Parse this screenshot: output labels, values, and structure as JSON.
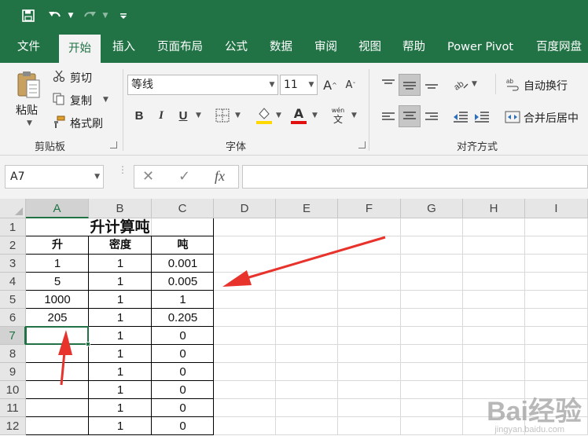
{
  "quick_access": {
    "save_icon": "save-icon",
    "undo_icon": "undo-icon",
    "redo_icon": "redo-icon",
    "customize_icon": "customize-qat-icon"
  },
  "tabs": [
    "文件",
    "开始",
    "插入",
    "页面布局",
    "公式",
    "数据",
    "审阅",
    "视图",
    "帮助",
    "Power Pivot",
    "百度网盘"
  ],
  "active_tab": "开始",
  "ribbon": {
    "clipboard": {
      "paste": "粘贴",
      "cut": "剪切",
      "copy": "复制",
      "format_painter": "格式刷",
      "group_label": "剪贴板"
    },
    "font": {
      "font_name": "等线",
      "font_size": "11",
      "grow": "A",
      "shrink": "A",
      "bold": "B",
      "italic": "I",
      "underline": "U",
      "font_color_letter": "A",
      "phonetic_top": "wén",
      "phonetic_bottom": "文",
      "group_label": "字体"
    },
    "alignment": {
      "wrap_text": "自动换行",
      "merge_center": "合并后居中",
      "group_label": "对齐方式"
    }
  },
  "formula_bar": {
    "name_box": "A7",
    "cancel": "✕",
    "enter": "✓",
    "fx": "fx",
    "formula": ""
  },
  "sheet": {
    "columns": [
      "A",
      "B",
      "C",
      "D",
      "E",
      "F",
      "G",
      "H",
      "I"
    ],
    "rows": [
      "1",
      "2",
      "3",
      "4",
      "5",
      "6",
      "7",
      "8",
      "9",
      "10",
      "11",
      "12"
    ],
    "selected_cell": "A7",
    "title": "升计算吨",
    "headers": [
      "升",
      "密度",
      "吨"
    ],
    "data": [
      [
        "1",
        "1",
        "0.001"
      ],
      [
        "5",
        "1",
        "0.005"
      ],
      [
        "1000",
        "1",
        "1"
      ],
      [
        "205",
        "1",
        "0.205"
      ],
      [
        "",
        "1",
        "0"
      ],
      [
        "",
        "1",
        "0"
      ],
      [
        "",
        "1",
        "0"
      ],
      [
        "",
        "1",
        "0"
      ],
      [
        "",
        "1",
        "0"
      ],
      [
        "",
        "1",
        "0"
      ]
    ]
  },
  "watermark": {
    "text": "Bai经验",
    "sub": "jingyan.baidu.com"
  },
  "colors": {
    "excel_green": "#217346",
    "annotation_red": "#e8322c"
  }
}
